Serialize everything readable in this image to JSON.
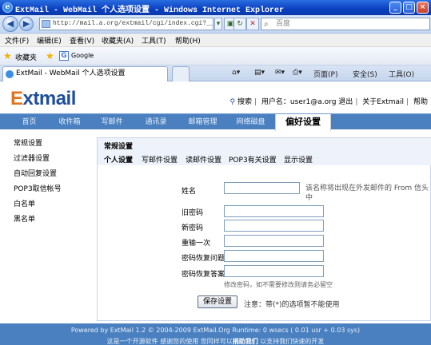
{
  "browser": {
    "window_title": "ExtMail - WebMail 个人选项设置 - Windows Internet Explorer",
    "address": "http://mail.a.org/extmail/cgi/index.cgi?__",
    "search_placeholder": "百度",
    "menu": [
      "文件(F)",
      "编辑(E)",
      "查看(V)",
      "收藏夹(A)",
      "工具(T)",
      "帮助(H)"
    ],
    "favorites_label": "收藏夹",
    "favorites_items": [
      "Google"
    ],
    "tab_title": "ExtMail - WebMail 个人选项设置",
    "tools": {
      "page": "页面(P)",
      "safety": "安全(S)",
      "tools": "工具(O)"
    }
  },
  "app": {
    "logo_e": "E",
    "logo_rest": "xtmail",
    "top_links": {
      "search": "搜索",
      "user": "用户名：user1@a.org",
      "logout": "退出",
      "about": "关于Extmail",
      "help": "帮助"
    },
    "nav": [
      "首页",
      "收件箱",
      "写邮件",
      "通讯录",
      "邮箱管理",
      "网络磁盘",
      "偏好设置"
    ],
    "sidebar": [
      "常规设置",
      "过滤器设置",
      "自动回复设置",
      "POP3取信帐号",
      "白名单",
      "黑名单"
    ],
    "panel_title": "常规设置",
    "subtabs": [
      "个人设置",
      "写邮件设置",
      "读邮件设置",
      "POP3有关设置",
      "显示设置"
    ],
    "form": {
      "name_label": "姓名",
      "name_hint": "该名称将出现在外发邮件的 From 信头中",
      "old_pw_label": "旧密码",
      "new_pw_label": "新密码",
      "repeat_label": "重输一次",
      "question_label": "密码恢复问题",
      "answer_label": "密码恢复答案",
      "pw_hint": "修改密码，如不需要修改则请务必留空",
      "save": "保存设置",
      "note": "注意：带(*)的选项暂不能使用"
    },
    "footer": {
      "line1": "Powered by ExtMail 1.2 © 2004-2009 ExtMail.Org Runtime: 0 wsecs ( 0.01 usr + 0.03 sys)",
      "line2_a": "这是一个开源软件 感谢您的使用 您同样可以",
      "line2_b": "捐助我们",
      "line2_c": " 以支持我们快速的开发"
    }
  }
}
